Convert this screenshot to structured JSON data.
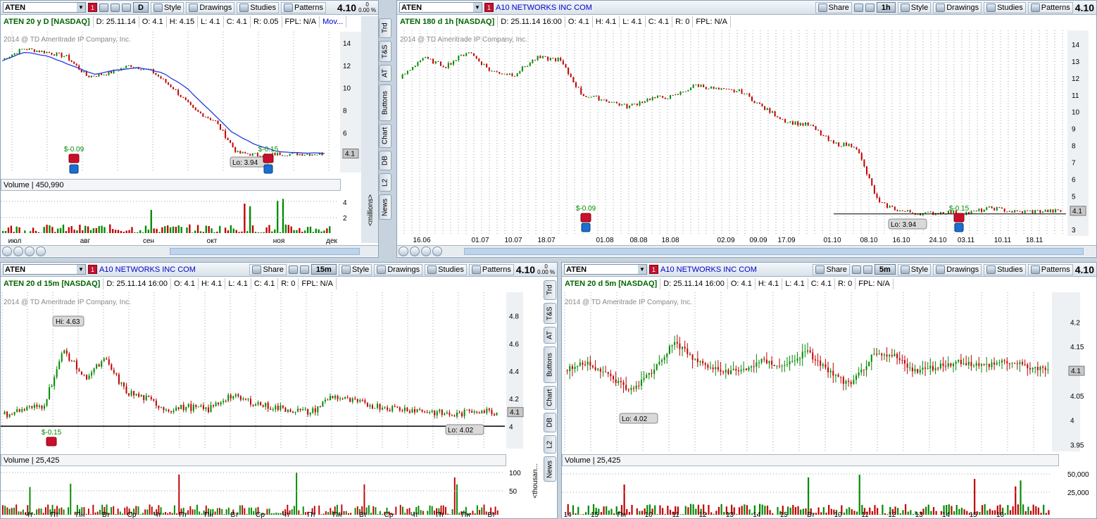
{
  "symbol": "ATEN",
  "company": "A10 NETWORKS INC COM",
  "copyright": "2014 @ TD Ameritrade IP Company, Inc.",
  "buttons": {
    "share": "Share",
    "style": "Style",
    "drawings": "Drawings",
    "studies": "Studies",
    "patterns": "Patterns"
  },
  "price": "4.10",
  "change": "0",
  "change_pct": "0.00 %",
  "side_tabs": [
    "Trd",
    "T&S",
    "AT",
    "Buttons",
    "Chart",
    "DB",
    "L2",
    "News"
  ],
  "p1": {
    "period": "D",
    "title": "ATEN 20 y D [NASDAQ]",
    "date": "D: 25.11.14",
    "o": "O: 4.1",
    "h": "H: 4.15",
    "l": "L: 4.1",
    "c": "C: 4.1",
    "r": "R: 0.05",
    "fpl": "FPL: N/A",
    "mov": "Mov...",
    "yticks": [
      "14",
      "12",
      "10",
      "8",
      "6",
      "4"
    ],
    "last": "4.1",
    "lo": "Lo: 3.94",
    "earn": "$-0.09",
    "earn2": "$-0.15",
    "vol_label": "Volume",
    "vol": "450,990",
    "vticks": [
      "4",
      "2"
    ],
    "unit": "<millions>",
    "xticks": [
      "июл",
      "авг",
      "сен",
      "окт",
      "ноя",
      "дек"
    ]
  },
  "p2": {
    "period": "1h",
    "title": "ATEN 180 d 1h [NASDAQ]",
    "date": "D: 25.11.14 16:00",
    "o": "O: 4.1",
    "h": "H: 4.1",
    "l": "L: 4.1",
    "c": "C: 4.1",
    "r": "R: 0",
    "fpl": "FPL: N/A",
    "yticks": [
      "14",
      "13",
      "12",
      "11",
      "10",
      "9",
      "8",
      "7",
      "6",
      "5",
      "4",
      "3"
    ],
    "last": "4.1",
    "lo": "Lo: 3.94",
    "earn": "$-0.09",
    "earn2": "$-0.15",
    "xticks": [
      "16.06",
      "01.07",
      "10.07",
      "18.07",
      "01.08",
      "08.08",
      "18.08",
      "02.09",
      "09.09",
      "17.09",
      "01.10",
      "08.10",
      "16.10",
      "24.10",
      "03.11",
      "10.11",
      "18.11"
    ]
  },
  "p3": {
    "period": "15m",
    "title": "ATEN 20 d 15m [NASDAQ]",
    "date": "D: 25.11.14 16:00",
    "o": "O: 4.1",
    "h": "H: 4.1",
    "l": "L: 4.1",
    "c": "C: 4.1",
    "r": "R: 0",
    "fpl": "FPL: N/A",
    "yticks": [
      "4.8",
      "4.6",
      "4.4",
      "4.2",
      "4"
    ],
    "last": "4.1",
    "hi": "Hi: 4.63",
    "lo": "Lo: 4.02",
    "earn": "$-0.15",
    "vol_label": "Volume",
    "vol": "25,425",
    "vticks": [
      "100",
      "50"
    ],
    "unit": "<thousan...",
    "xticks": [
      "Чт",
      "Пт",
      "Пн",
      "Вт",
      "Ср",
      "Чт",
      "Пт",
      "Пн",
      "Вт",
      "Ср",
      "Чт",
      "Пт",
      "Пн",
      "Вт",
      "Ср",
      "Чт",
      "Пт",
      "Пн",
      "Вт"
    ]
  },
  "p4": {
    "period": "5m",
    "title": "ATEN 20 d 5m [NASDAQ]",
    "date": "D: 25.11.14 16:00",
    "o": "O: 4.1",
    "h": "H: 4.1",
    "l": "L: 4.1",
    "c": "C: 4.1",
    "r": "R: 0",
    "fpl": "FPL: N/A",
    "yticks": [
      "4.2",
      "4.15",
      "4.1",
      "4.05",
      "4",
      "3.95"
    ],
    "last": "4.1",
    "lo": "Lo: 4.02",
    "vol_label": "Volume",
    "vol": "25,425",
    "vticks": [
      "50,000",
      "25,000"
    ],
    "xticks": [
      "14",
      "15",
      "Пн",
      "10",
      "11",
      "12",
      "13",
      "14",
      "15",
      "Вт",
      "10",
      "11",
      "12",
      "13",
      "14",
      "15",
      "16"
    ]
  }
}
